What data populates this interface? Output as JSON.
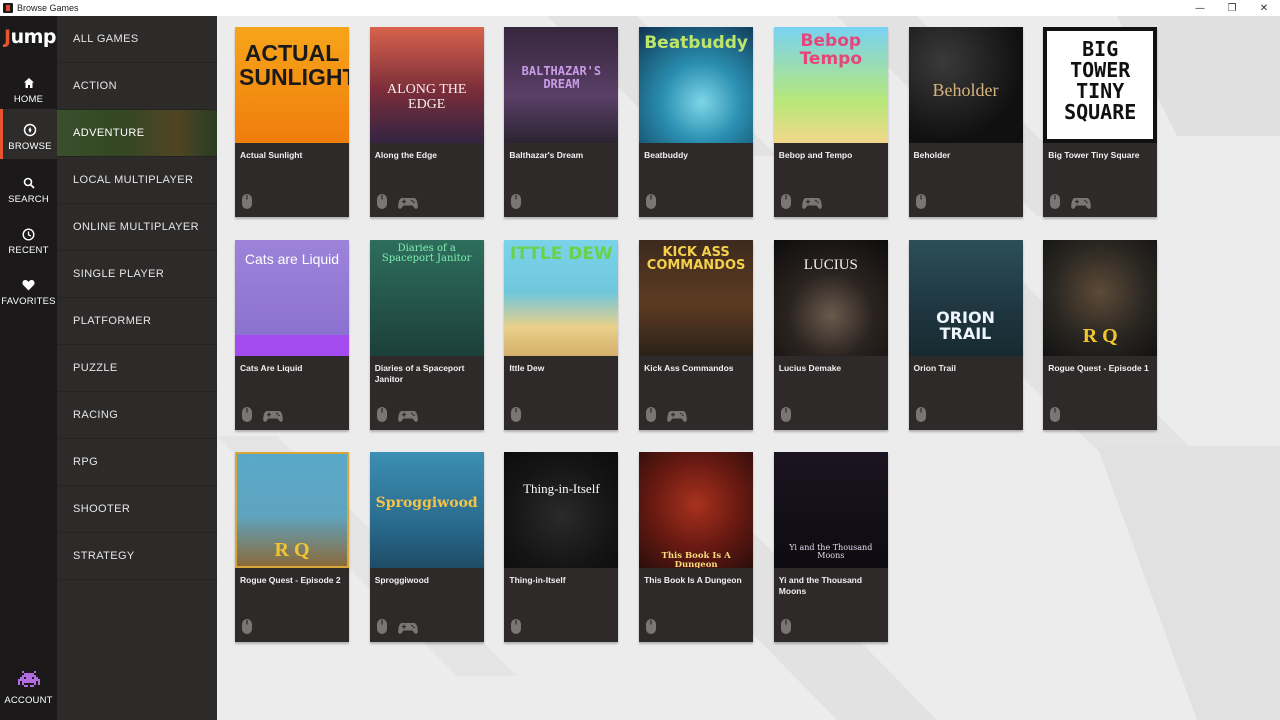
{
  "window": {
    "title": "Browse Games",
    "controls": [
      "—",
      "❐",
      "✕"
    ]
  },
  "brand": {
    "logo_first": "J",
    "logo_rest": "ump"
  },
  "rail": {
    "items": [
      {
        "label": "HOME",
        "icon": "home-icon",
        "active": false
      },
      {
        "label": "BROWSE",
        "icon": "compass-icon",
        "active": true
      },
      {
        "label": "SEARCH",
        "icon": "search-icon",
        "active": false
      },
      {
        "label": "RECENT",
        "icon": "clock-icon",
        "active": false
      },
      {
        "label": "FAVORITES",
        "icon": "heart-icon",
        "active": false
      }
    ],
    "account": {
      "label": "ACCOUNT",
      "icon": "space-invader-icon"
    }
  },
  "categories": [
    "ALL GAMES",
    "ACTION",
    "ADVENTURE",
    "LOCAL MULTIPLAYER",
    "ONLINE MULTIPLAYER",
    "SINGLE PLAYER",
    "PLATFORMER",
    "PUZZLE",
    "RACING",
    "RPG",
    "SHOOTER",
    "STRATEGY"
  ],
  "selected_category": "ADVENTURE",
  "colors": {
    "accent": "#e8552f",
    "rail_bg": "#1b1919",
    "sidebar_bg": "#2d2a2a",
    "card_bg": "#2e2a2a",
    "main_bg": "#ececec"
  },
  "games": [
    {
      "title": "Actual Sunlight",
      "controls": [
        "mouse"
      ],
      "cover_text": "ACTUAL SUNLIGHT"
    },
    {
      "title": "Along the Edge",
      "controls": [
        "mouse",
        "gamepad"
      ],
      "cover_text": "ALONG THE EDGE"
    },
    {
      "title": "Balthazar's Dream",
      "controls": [
        "mouse"
      ],
      "cover_text": "BALTHAZAR'S DREAM"
    },
    {
      "title": "Beatbuddy",
      "controls": [
        "mouse"
      ],
      "cover_text": "Beatbuddy"
    },
    {
      "title": "Bebop and Tempo",
      "controls": [
        "mouse",
        "gamepad"
      ],
      "cover_text": "Bebop Tempo"
    },
    {
      "title": "Beholder",
      "controls": [
        "mouse"
      ],
      "cover_text": "Beholder"
    },
    {
      "title": "Big Tower Tiny Square",
      "controls": [
        "mouse",
        "gamepad"
      ],
      "cover_text": "BIG TOWER TINY SQUARE"
    },
    {
      "title": "Cats Are Liquid",
      "controls": [
        "mouse",
        "gamepad"
      ],
      "cover_text": "Cats are Liquid"
    },
    {
      "title": "Diaries of a Spaceport Janitor",
      "controls": [
        "mouse",
        "gamepad"
      ],
      "cover_text": "Diaries of a Spaceport Janitor"
    },
    {
      "title": "Ittle Dew",
      "controls": [
        "mouse"
      ],
      "cover_text": "ITTLE DEW"
    },
    {
      "title": "Kick Ass Commandos",
      "controls": [
        "mouse",
        "gamepad"
      ],
      "cover_text": "KICK ASS COMMANDOS"
    },
    {
      "title": "Lucius Demake",
      "controls": [
        "mouse"
      ],
      "cover_text": "LUCIUS"
    },
    {
      "title": "Orion Trail",
      "controls": [
        "mouse"
      ],
      "cover_text": "ORION TRAIL"
    },
    {
      "title": "Rogue Quest - Episode 1",
      "controls": [
        "mouse"
      ],
      "cover_text": "R Q"
    },
    {
      "title": "Rogue Quest - Episode 2",
      "controls": [
        "mouse"
      ],
      "cover_text": "R Q"
    },
    {
      "title": "Sproggiwood",
      "controls": [
        "mouse",
        "gamepad"
      ],
      "cover_text": "Sproggiwood"
    },
    {
      "title": "Thing-in-Itself",
      "controls": [
        "mouse"
      ],
      "cover_text": "Thing-in-Itself"
    },
    {
      "title": "This Book Is A Dungeon",
      "controls": [
        "mouse"
      ],
      "cover_text": "This Book Is A Dungeon"
    },
    {
      "title": "Yi and the Thousand Moons",
      "controls": [
        "mouse"
      ],
      "cover_text": "Yi and the Thousand Moons"
    }
  ]
}
